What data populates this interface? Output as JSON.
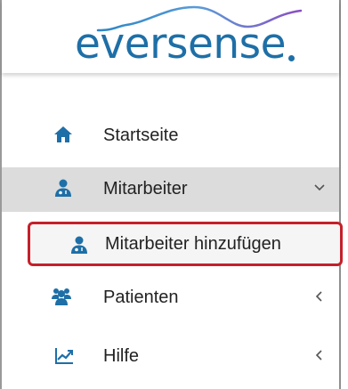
{
  "brand": {
    "logo_text": "eversense",
    "color": "#1e6fa7"
  },
  "nav": {
    "items": [
      {
        "label": "Startseite",
        "icon": "home-icon"
      },
      {
        "label": "Mitarbeiter",
        "icon": "user-doctor-icon",
        "expanded": true,
        "chevron": "chevron-down-icon"
      },
      {
        "label": "Patienten",
        "icon": "users-icon",
        "chevron": "chevron-left-icon"
      },
      {
        "label": "Hilfe",
        "icon": "line-chart-icon",
        "chevron": "chevron-left-icon"
      }
    ],
    "sub_items": [
      {
        "label": "Mitarbeiter hinzufügen",
        "icon": "user-doctor-icon",
        "highlighted": true
      }
    ]
  },
  "colors": {
    "accent_blue": "#1e6fa7",
    "active_bg": "#dcdcdc",
    "highlight_border": "#c4202a"
  }
}
